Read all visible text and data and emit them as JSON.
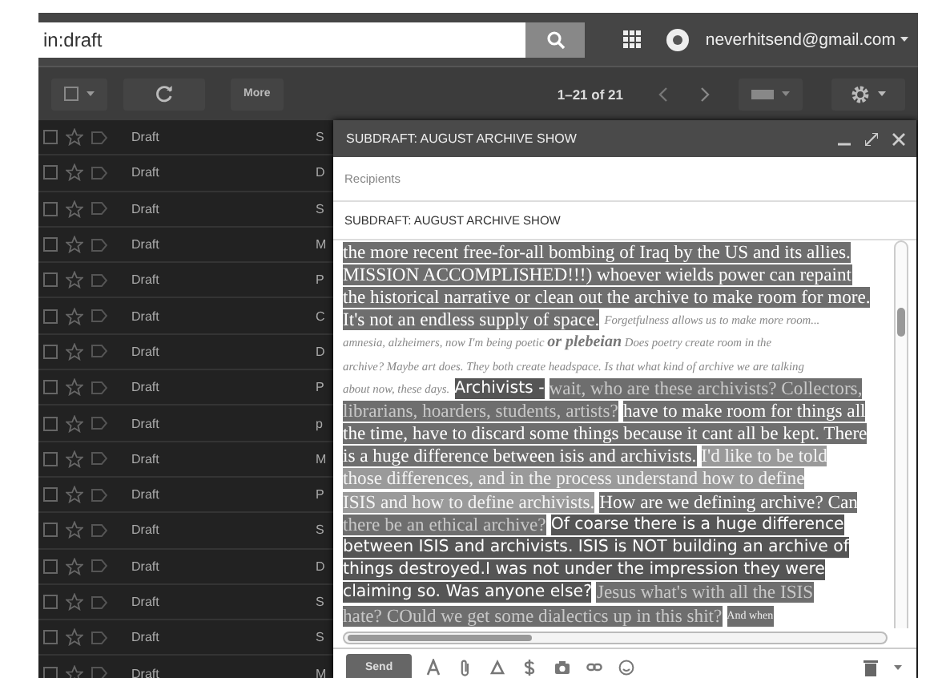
{
  "search": {
    "value": "in:draft"
  },
  "account": {
    "email": "neverhitsend@gmail.com"
  },
  "toolbar": {
    "more_label": "More",
    "page_range": "1–21 of 21"
  },
  "messages": [
    {
      "label": "Draft",
      "subject": "S"
    },
    {
      "label": "Draft",
      "subject": "D"
    },
    {
      "label": "Draft",
      "subject": "S"
    },
    {
      "label": "Draft",
      "subject": "M"
    },
    {
      "label": "Draft",
      "subject": "P"
    },
    {
      "label": "Draft",
      "subject": "C"
    },
    {
      "label": "Draft",
      "subject": "D"
    },
    {
      "label": "Draft",
      "subject": "P"
    },
    {
      "label": "Draft",
      "subject": "p"
    },
    {
      "label": "Draft",
      "subject": "M"
    },
    {
      "label": "Draft",
      "subject": "P"
    },
    {
      "label": "Draft",
      "subject": "S"
    },
    {
      "label": "Draft",
      "subject": "D"
    },
    {
      "label": "Draft",
      "subject": "S"
    },
    {
      "label": "Draft",
      "subject": "S"
    },
    {
      "label": "Draft",
      "subject": "M"
    }
  ],
  "compose": {
    "title": "SUBDRAFT: AUGUST ARCHIVE SHOW",
    "recipients_placeholder": "Recipients",
    "subject": "SUBDRAFT: AUGUST ARCHIVE SHOW",
    "body_lines": [
      {
        "parts": [
          {
            "kind": "mark-dark",
            "text": "the more recent free-for-all bombing of Iraq by the US and its allies."
          }
        ]
      },
      {
        "parts": [
          {
            "kind": "mark-dark",
            "text": "MISSION ACCOMPLISHED!!!) whoever wields power can repaint"
          }
        ]
      },
      {
        "parts": [
          {
            "kind": "mark-dark",
            "text": "the historical narrative or clean out the archive to make room for more."
          }
        ]
      },
      {
        "parts": [
          {
            "kind": "mark-dark",
            "text": "It's not an endless supply of space."
          },
          {
            "kind": "note",
            "text": "Forgetfulness allows us to make more room..."
          }
        ]
      },
      {
        "parts": [
          {
            "kind": "note",
            "text": "amnesia, alzheimers, now I'm being poetic **or plebeian** Does poetry create room in the"
          }
        ]
      },
      {
        "parts": [
          {
            "kind": "note",
            "text": "archive? Maybe art does. They both create headspace. Is that what kind of archive we are talking"
          }
        ]
      },
      {
        "parts": [
          {
            "kind": "note",
            "text": "about now, these days."
          },
          {
            "kind": "mark-sans",
            "text": "Archivists -"
          },
          {
            "kind": "mark-faint",
            "text": "wait, who are these archivists? Collectors,"
          }
        ]
      },
      {
        "parts": [
          {
            "kind": "mark-faint",
            "text": "librarians, hoarders, students, artists?"
          },
          {
            "kind": "mark-dark",
            "text": "have to make room for things all"
          }
        ]
      },
      {
        "parts": [
          {
            "kind": "mark-dark",
            "text": "the time, have to discard some things because it cant all be kept. There"
          }
        ]
      },
      {
        "parts": [
          {
            "kind": "mark-dark",
            "text": "is a huge difference between isis and archivists."
          },
          {
            "kind": "mark-light",
            "text": "I'd like to be told"
          }
        ]
      },
      {
        "parts": [
          {
            "kind": "mark-light",
            "text": "those differences, and in the process understand how to define"
          }
        ]
      },
      {
        "parts": [
          {
            "kind": "mark-light",
            "text": "ISIS and how to define archivists."
          },
          {
            "kind": "mark-dark",
            "text": "How are we defining archive? Can"
          }
        ]
      },
      {
        "parts": [
          {
            "kind": "mark-faint",
            "text": "there be an ethical archive?"
          },
          {
            "kind": "mark-sans",
            "text": "Of coarse there is a huge difference"
          }
        ]
      },
      {
        "parts": [
          {
            "kind": "mark-sans",
            "text": "between ISIS and archivists. ISIS is NOT building an archive of"
          }
        ]
      },
      {
        "parts": [
          {
            "kind": "mark-sans",
            "text": "things destroyed.I was not under the impression they were"
          }
        ]
      },
      {
        "parts": [
          {
            "kind": "mark-sans",
            "text": "claiming so. Was anyone else?"
          },
          {
            "kind": "mark-faint",
            "text": "Jesus what's with all the ISIS"
          }
        ]
      },
      {
        "parts": [
          {
            "kind": "mark-faint",
            "text": "hate? COuld we get some dialectics up in this shit?"
          },
          {
            "kind": "mark-small",
            "text": "And when"
          }
        ]
      }
    ],
    "send_label": "Send"
  }
}
